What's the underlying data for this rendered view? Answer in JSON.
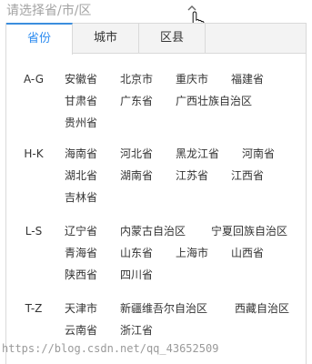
{
  "picker": {
    "placeholder": "请选择省/市/区",
    "caret_icon": "chevron-up-icon",
    "cursor_icon": "hand-pointer-icon"
  },
  "tabs": [
    {
      "label": "省份",
      "active": true
    },
    {
      "label": "城市",
      "active": false
    },
    {
      "label": "区县",
      "active": false
    }
  ],
  "groups": [
    {
      "label": "A-G",
      "items": [
        "安徽省",
        "北京市",
        "重庆市",
        "福建省",
        "甘肃省",
        "广东省",
        "广西壮族自治区",
        "贵州省"
      ]
    },
    {
      "label": "H-K",
      "items": [
        "海南省",
        "河北省",
        "黑龙江省",
        "河南省",
        "湖北省",
        "湖南省",
        "江苏省",
        "江西省",
        "吉林省"
      ]
    },
    {
      "label": "L-S",
      "items": [
        "辽宁省",
        "内蒙古自治区",
        "宁夏回族自治区",
        "青海省",
        "山东省",
        "上海市",
        "山西省",
        "陕西省",
        "四川省"
      ]
    },
    {
      "label": "T-Z",
      "items": [
        "天津市",
        "新疆维吾尔自治区",
        "西藏自治区",
        "云南省",
        "浙江省"
      ]
    }
  ],
  "watermark": "https://blog.csdn.net/qq_43652509",
  "colors": {
    "accent": "#2d8cf0",
    "border": "#d9d9d9",
    "tab_bg": "#f3f3f3"
  }
}
